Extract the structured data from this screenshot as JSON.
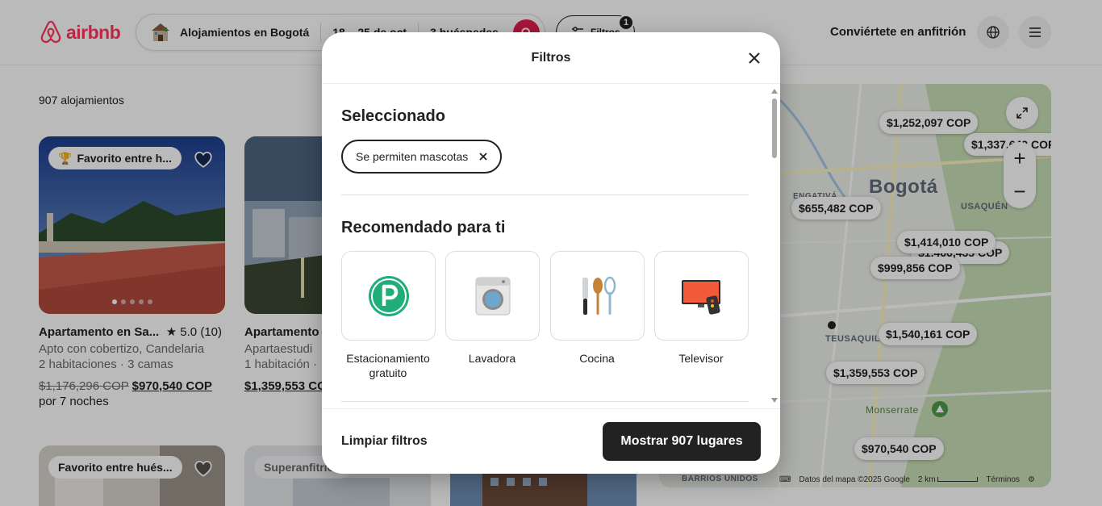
{
  "header": {
    "logo_text": "airbnb",
    "search": {
      "location": "Alojamientos en Bogotá",
      "dates": "18 – 25 de oct",
      "guests": "3 huéspedes"
    },
    "filters_label": "Filtros",
    "filters_count": "1",
    "host_link": "Conviértete en anfitrión"
  },
  "results": {
    "count": "907 alojamientos",
    "cards": [
      {
        "badge": "Favorito entre h...",
        "title": "Apartamento en Sa...",
        "rating": "★ 5.0 (10)",
        "subtitle": "Apto con cobertizo, Candelaria",
        "details": "2 habitaciones · 3 camas",
        "old_price": "$1,176,296 COP",
        "price": "$970,540 COP",
        "nights": "por 7 noches"
      },
      {
        "title": "Apartamento",
        "subtitle": "Apartaestudi",
        "details": "1 habitación ·",
        "price": "$1,359,553 CO"
      },
      {
        "badge": "Favorito entre hués..."
      },
      {
        "badge": "Superanfitrión"
      }
    ]
  },
  "map": {
    "city_label": "Bogotá",
    "area_labels": [
      "ENGATIVÁ",
      "USAQUÉN",
      "TEUSAQUILLO",
      "Monserrate",
      "BARRIOS UNIDOS"
    ],
    "pins": [
      "$1,252,097 COP",
      "$1,337,642 COP",
      "$655,482 COP",
      "$1,414,010 COP",
      "$1,466,435 COP",
      "$999,856 COP",
      "$1,540,161 COP",
      "$1,359,553 COP",
      "$970,540 COP"
    ],
    "footer": {
      "data": "Datos del mapa ©2025 Google",
      "scale": "2 km",
      "terms": "Términos"
    }
  },
  "modal": {
    "title": "Filtros",
    "selected_heading": "Seleccionado",
    "selected_chip": "Se permiten mascotas",
    "recommended_heading": "Recomendado para ti",
    "amenities": [
      {
        "label": "Estacionamiento gratuito",
        "icon": "parking-icon"
      },
      {
        "label": "Lavadora",
        "icon": "washing-machine-icon"
      },
      {
        "label": "Cocina",
        "icon": "kitchen-utensils-icon"
      },
      {
        "label": "Televisor",
        "icon": "tv-icon"
      }
    ],
    "clear_label": "Limpiar filtros",
    "show_label": "Mostrar 907 lugares"
  },
  "colors": {
    "brand": "#ff385c",
    "search_button": "#e61e4d",
    "primary_button": "#222222"
  }
}
